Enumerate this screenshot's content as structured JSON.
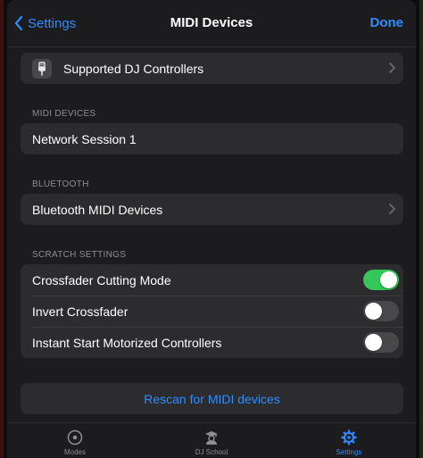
{
  "navbar": {
    "back_label": "Settings",
    "title": "MIDI Devices",
    "done_label": "Done"
  },
  "controllers_row": {
    "label": "Supported DJ Controllers"
  },
  "midi_devices": {
    "header": "MIDI DEVICES",
    "items": [
      {
        "label": "Network Session 1"
      }
    ]
  },
  "bluetooth": {
    "header": "BLUETOOTH",
    "row_label": "Bluetooth MIDI Devices"
  },
  "scratch": {
    "header": "SCRATCH SETTINGS",
    "items": [
      {
        "label": "Crossfader Cutting Mode",
        "on": true
      },
      {
        "label": "Invert Crossfader",
        "on": false
      },
      {
        "label": "Instant Start Motorized Controllers",
        "on": false
      }
    ]
  },
  "rescan_label": "Rescan for MIDI devices",
  "tabs": [
    {
      "label": "Modes",
      "icon": "modes-icon",
      "active": false
    },
    {
      "label": "DJ School",
      "icon": "dj-school-icon",
      "active": false
    },
    {
      "label": "Settings",
      "icon": "gear-icon",
      "active": true
    }
  ],
  "colors": {
    "accent": "#2f8cff",
    "toggle_on": "#34c759",
    "cell_bg": "#2c2c2e",
    "sheet_bg": "#1c1c1e"
  }
}
